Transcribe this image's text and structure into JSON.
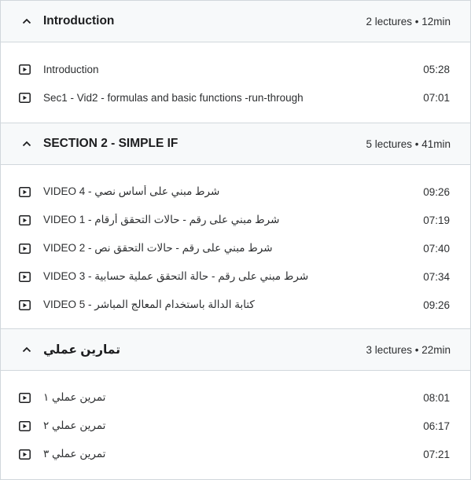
{
  "sections": [
    {
      "title": "Introduction",
      "meta": "2 lectures • 12min",
      "lectures": [
        {
          "title": "Introduction",
          "duration": "05:28"
        },
        {
          "title": "Sec1 - Vid2 - formulas and basic functions -run-through",
          "duration": "07:01"
        }
      ]
    },
    {
      "title": "SECTION 2 - SIMPLE IF",
      "meta": "5 lectures • 41min",
      "lectures": [
        {
          "title": "VIDEO 4 - شرط مبني على أساس نصي",
          "duration": "09:26"
        },
        {
          "title": "VIDEO 1 - شرط مبني على رقم - حالات التحقق أرقام",
          "duration": "07:19"
        },
        {
          "title": "VIDEO 2 - شرط مبني على رقم - حالات التحقق نص",
          "duration": "07:40"
        },
        {
          "title": "VIDEO 3 - شرط مبني على رقم - حالة التحقق عملية حسابية",
          "duration": "07:34"
        },
        {
          "title": "VIDEO 5 - كتابة الدالة باستخدام المعالج المباشر",
          "duration": "09:26"
        }
      ]
    },
    {
      "title": "تمارين عملي",
      "meta": "3 lectures • 22min",
      "lectures": [
        {
          "title": "تمرين عملي ١",
          "duration": "08:01"
        },
        {
          "title": "تمرين عملي ٢",
          "duration": "06:17"
        },
        {
          "title": "تمرين عملي ٣",
          "duration": "07:21"
        }
      ]
    }
  ],
  "icons": {
    "section_toggle": "chevron-up-icon",
    "lecture": "video-play-icon"
  }
}
